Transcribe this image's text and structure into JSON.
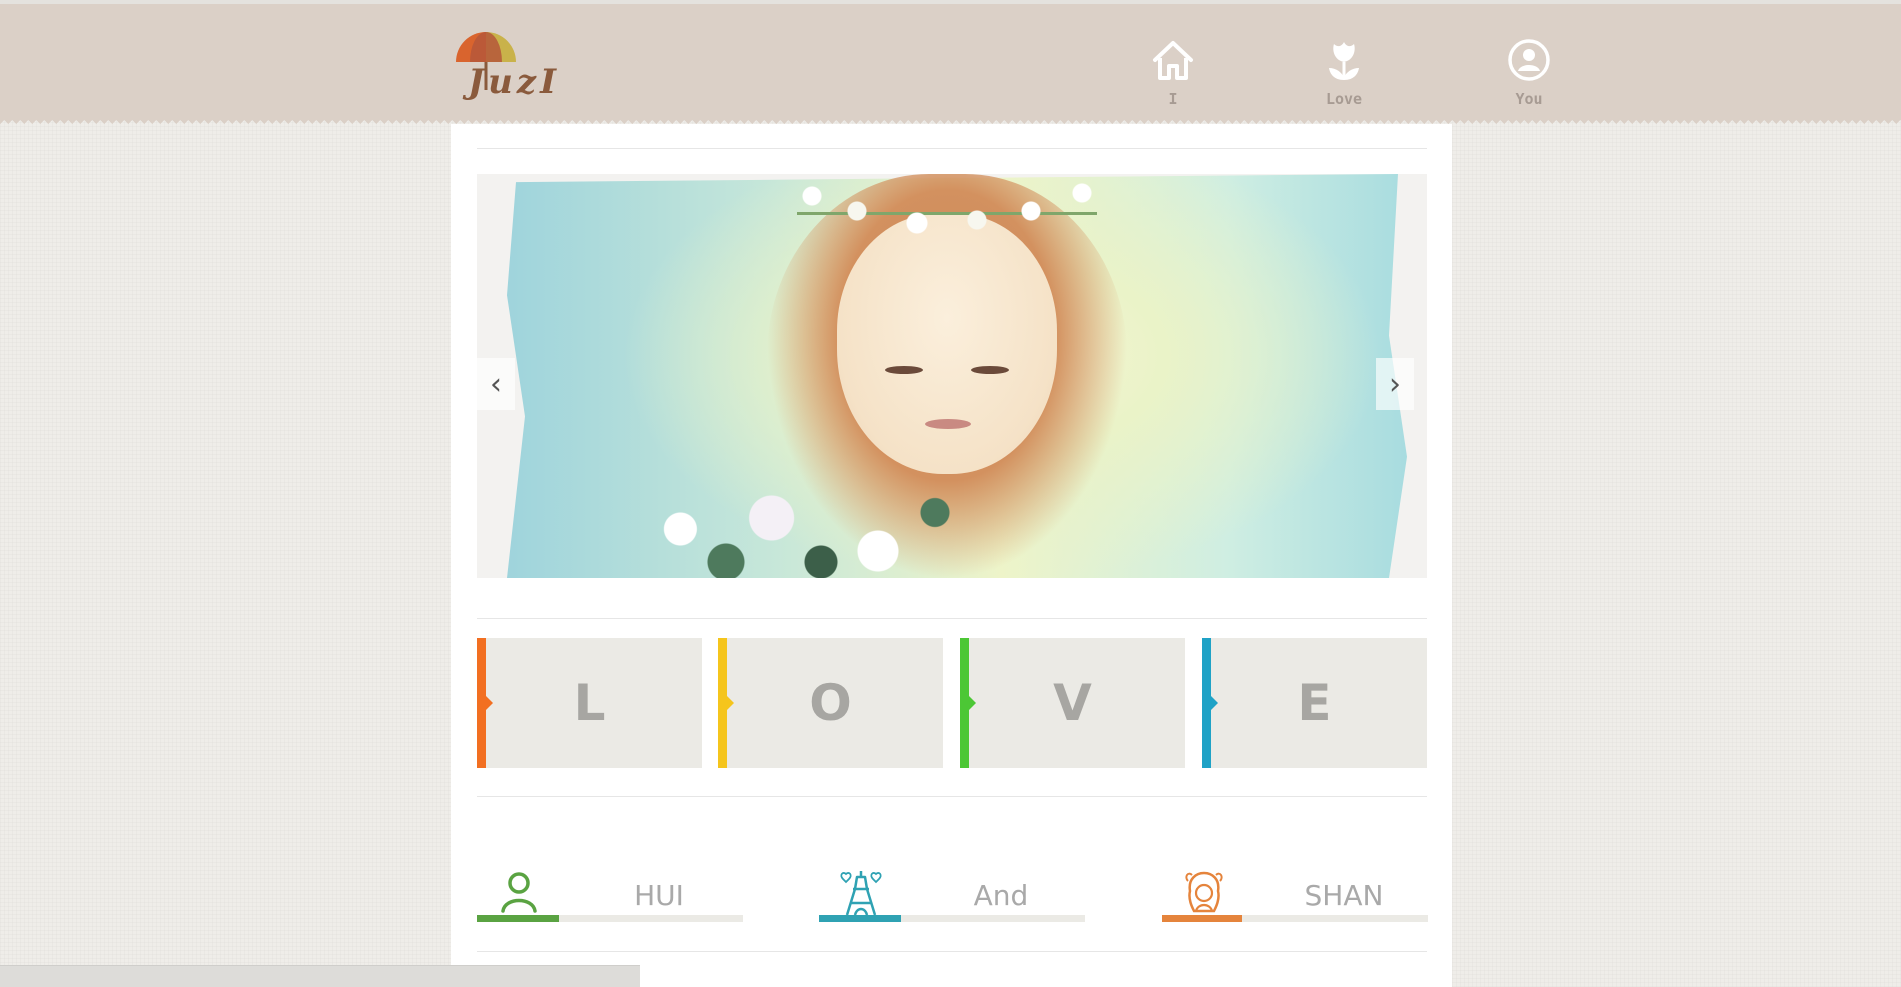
{
  "logo": {
    "text": "JuzI"
  },
  "nav": [
    {
      "label": "I",
      "icon": "home-icon"
    },
    {
      "label": "Love",
      "icon": "tulip-icon"
    },
    {
      "label": "You",
      "icon": "user-circle-icon"
    }
  ],
  "carousel": {
    "prev_icon": "‹",
    "next_icon": "›"
  },
  "love_tiles": [
    {
      "letter": "L",
      "color": "#f26f21"
    },
    {
      "letter": "O",
      "color": "#f5c51c"
    },
    {
      "letter": "V",
      "color": "#4cc735"
    },
    {
      "letter": "E",
      "color": "#1fa2c6"
    }
  ],
  "features": [
    {
      "label": "HUI",
      "icon": "person-icon",
      "color": "#5aa342",
      "progress": 0.31
    },
    {
      "label": "And",
      "icon": "eiffel-tower-icon",
      "color": "#2fa2b3",
      "progress": 0.31
    },
    {
      "label": "SHAN",
      "icon": "girl-icon",
      "color": "#e5843c",
      "progress": 0.3
    }
  ]
}
